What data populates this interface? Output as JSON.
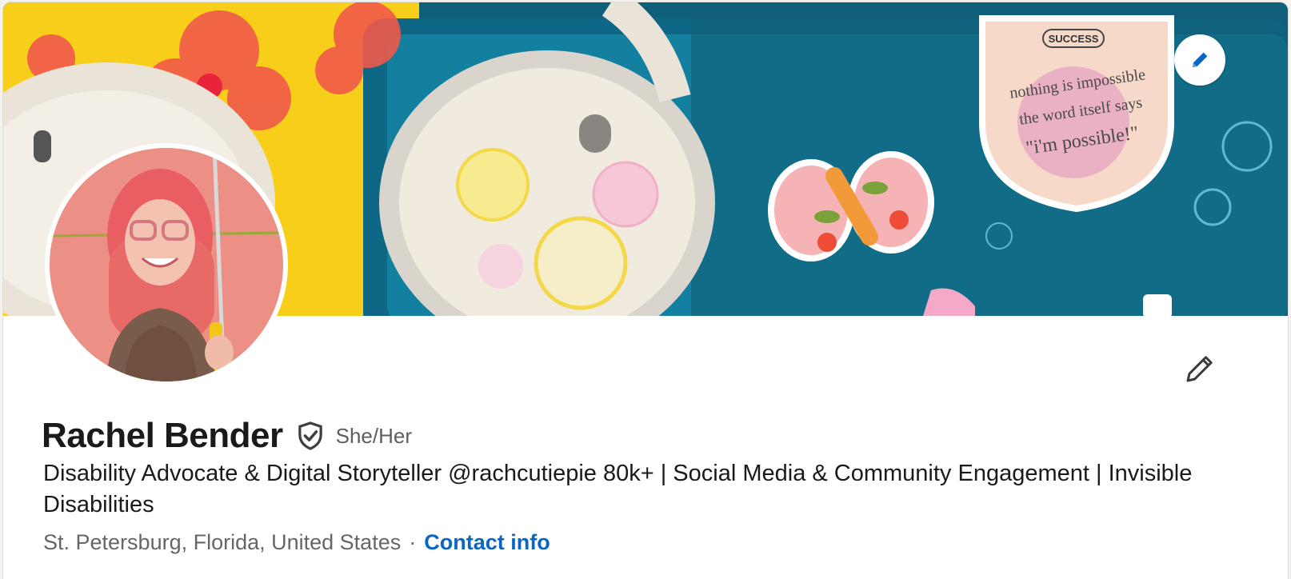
{
  "profile": {
    "name": "Rachel Bender",
    "pronouns": "She/Her",
    "headline": "Disability Advocate & Digital Storyteller @rachcutiepie 80k+ | Social Media & Community Engagement | Invisible Disabilities",
    "location": "St. Petersburg, Florida, United States",
    "separator": "·",
    "contact_label": "Contact info"
  },
  "banner": {
    "sticker_badge": "SUCCESS",
    "sticker_lines": [
      "nothing is impossible",
      "the word itself says",
      "\"i'm possible!\""
    ]
  },
  "icons": {
    "banner_edit": "pencil-icon",
    "intro_edit": "pencil-icon",
    "verified": "verified-shield-icon"
  },
  "colors": {
    "link": "#0a66c2",
    "name": "#1a1a1a",
    "secondary_text": "#666666"
  }
}
